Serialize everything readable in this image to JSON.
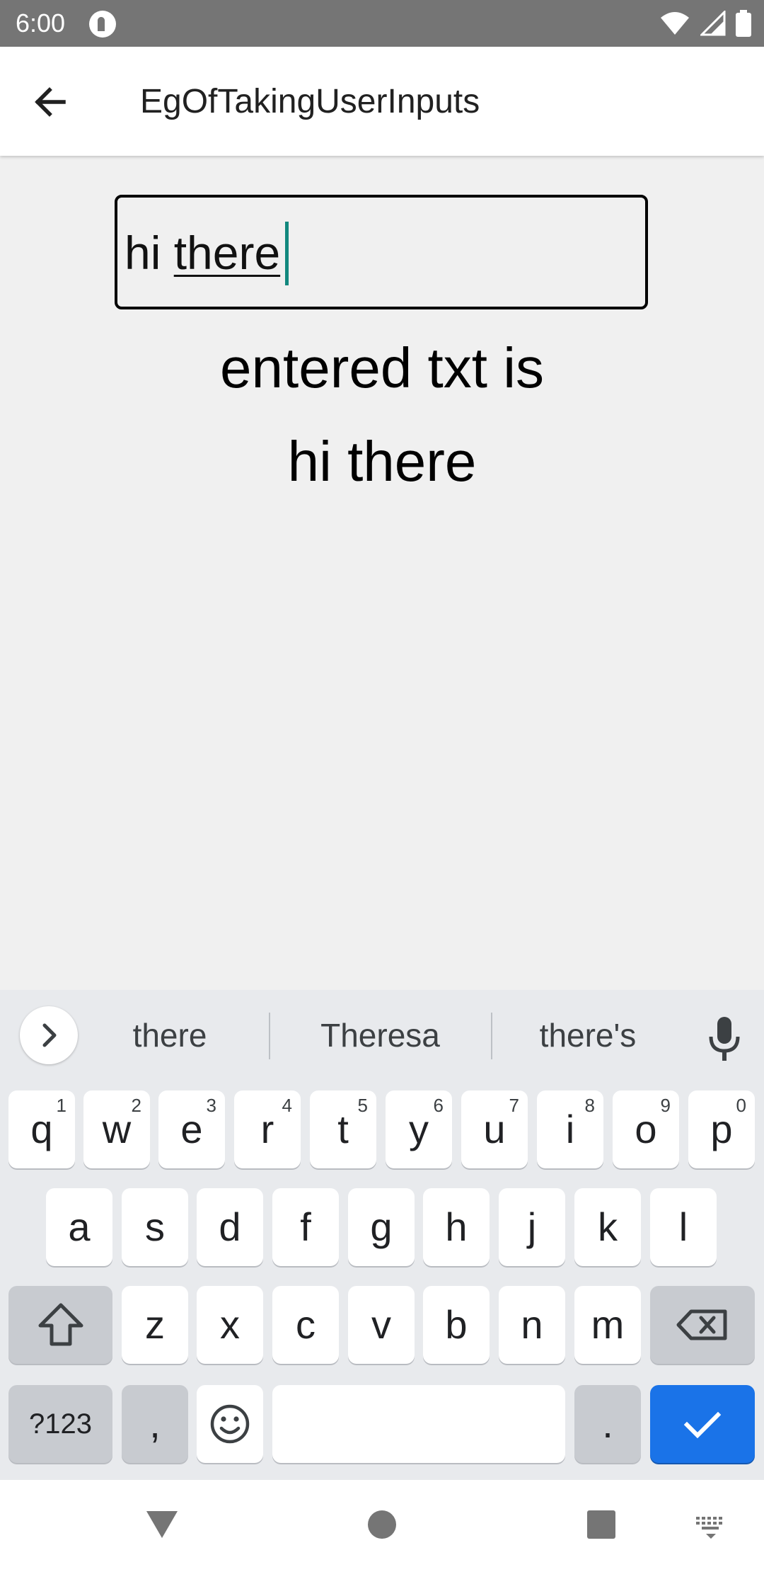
{
  "status_bar": {
    "time": "6:00",
    "icons": [
      "notification-p-icon",
      "wifi-icon",
      "signal-icon",
      "battery-icon"
    ]
  },
  "app_bar": {
    "title": "EgOfTakingUserInputs",
    "back_icon": "arrow-back-icon"
  },
  "input": {
    "value_prefix": "hi ",
    "value_composing": "there",
    "caret_color": "#11887e"
  },
  "output": {
    "label": "entered txt is",
    "value": "hi there"
  },
  "keyboard": {
    "suggestions": [
      "there",
      "Theresa",
      "there's"
    ],
    "row1": [
      {
        "key": "q",
        "hint": "1"
      },
      {
        "key": "w",
        "hint": "2"
      },
      {
        "key": "e",
        "hint": "3"
      },
      {
        "key": "r",
        "hint": "4"
      },
      {
        "key": "t",
        "hint": "5"
      },
      {
        "key": "y",
        "hint": "6"
      },
      {
        "key": "u",
        "hint": "7"
      },
      {
        "key": "i",
        "hint": "8"
      },
      {
        "key": "o",
        "hint": "9"
      },
      {
        "key": "p",
        "hint": "0"
      }
    ],
    "row2": [
      "a",
      "s",
      "d",
      "f",
      "g",
      "h",
      "j",
      "k",
      "l"
    ],
    "row3": [
      "z",
      "x",
      "c",
      "v",
      "b",
      "n",
      "m"
    ],
    "symbols_label": "?123",
    "comma_label": ",",
    "period_label": ".",
    "enter_color": "#1a73e8"
  },
  "nav_bar": {
    "icons": [
      "back-triangle-icon",
      "home-circle-icon",
      "recents-square-icon",
      "keyboard-switch-icon"
    ]
  }
}
